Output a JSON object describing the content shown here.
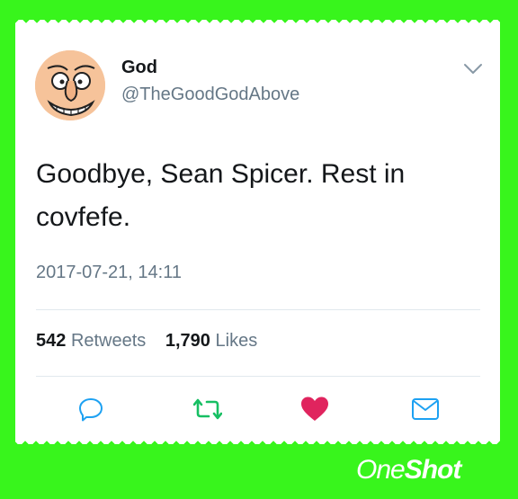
{
  "tweet": {
    "author_name": "God",
    "author_handle": "@TheGoodGodAbove",
    "text": "Goodbye, Sean Spicer. Rest in covfefe.",
    "timestamp": "2017-07-21, 14:11",
    "retweets_count": "542",
    "retweets_label": "Retweets",
    "likes_count": "1,790",
    "likes_label": "Likes"
  },
  "actions": [
    {
      "name": "reply-icon"
    },
    {
      "name": "retweet-icon"
    },
    {
      "name": "like-icon"
    },
    {
      "name": "share-icon"
    }
  ],
  "watermark": {
    "part1": "One",
    "part2": "Shot"
  },
  "colors": {
    "background": "#38f51c",
    "retweet": "#17bf63",
    "like": "#e0245e",
    "link": "#1da1f2",
    "muted": "#657786"
  }
}
